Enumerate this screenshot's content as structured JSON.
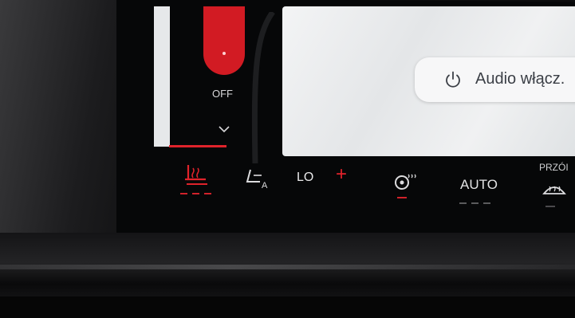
{
  "screen": {
    "audio_button": {
      "label": "Audio włącz.",
      "icon": "power-icon"
    },
    "temperature_slider": {
      "state_label": "OFF",
      "icon": "chevron-down-icon",
      "accent": "#d21b23"
    }
  },
  "climate_bar": {
    "seat_heat": {
      "icon": "seat-heat-icon",
      "color": "#e0232b"
    },
    "seat_auto": {
      "icon": "seat-auto-icon"
    },
    "temperature": {
      "value": "LO",
      "increase": "+"
    },
    "steering_wheel_heat": {
      "icon": "steering-wheel-heat-icon"
    },
    "auto": {
      "label": "AUTO"
    },
    "front_defrost": {
      "label": "PRZÓI",
      "icon": "front-defrost-icon"
    }
  }
}
